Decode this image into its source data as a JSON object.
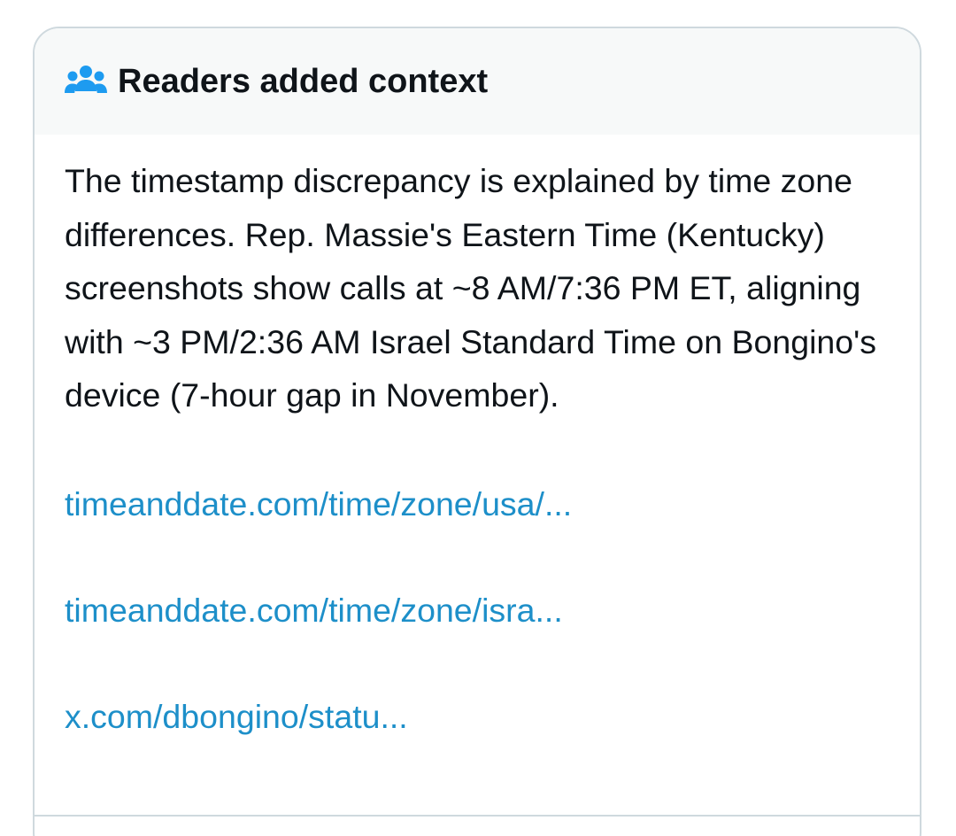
{
  "note": {
    "header_icon": "people-group-icon",
    "title": "Readers added context",
    "body": "The timestamp discrepancy is explained by time zone differences. Rep. Massie's Eastern Time (Kentucky) screenshots show calls at ~8 AM/7:36 PM ET, aligning with ~3 PM/2:36 AM Israel Standard Time on Bongino's device (7-hour gap in November).",
    "links": [
      "timeanddate.com/time/zone/usa/...",
      "timeanddate.com/time/zone/isra...",
      "x.com/dbongino/statu..."
    ]
  },
  "colors": {
    "icon": "#1d9bf0",
    "link": "#1d8fc9",
    "text": "#0f1419",
    "header_bg": "#f7f9f9",
    "border": "#cfd9de"
  }
}
